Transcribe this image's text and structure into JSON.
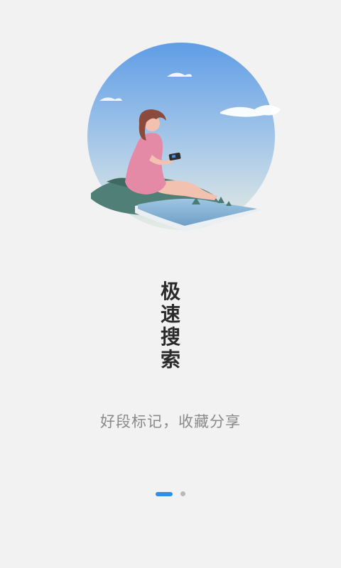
{
  "illustration": {
    "icon": "girl-reading-book-illustration"
  },
  "title": {
    "chars": [
      "极",
      "速",
      "搜",
      "索"
    ]
  },
  "subtitle": "好段标记，收藏分享",
  "pager": {
    "total": 2,
    "active_index": 0,
    "active_color": "#2f8fe8",
    "inactive_color": "#b9b9b9"
  }
}
